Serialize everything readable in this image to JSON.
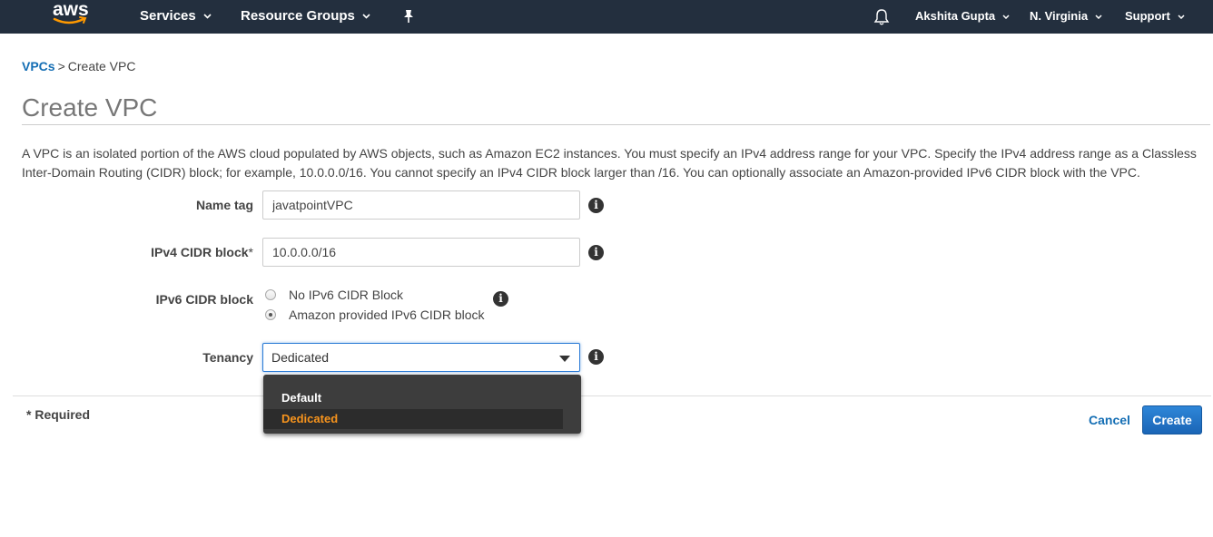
{
  "topnav": {
    "logo_text": "aws",
    "services": "Services",
    "resource_groups": "Resource Groups",
    "user": "Akshita Gupta",
    "region": "N. Virginia",
    "support": "Support",
    "icons": [
      "pin-icon",
      "bell-icon"
    ],
    "background_color": "#232f3e"
  },
  "breadcrumb": {
    "parent": "VPCs",
    "separator": ">",
    "current": "Create VPC"
  },
  "page_title": "Create VPC",
  "description": "A VPC is an isolated portion of the AWS cloud populated by AWS objects, such as Amazon EC2 instances. You must specify an IPv4 address range for your VPC. Specify the IPv4 address range as a Classless Inter-Domain Routing (CIDR) block; for example, 10.0.0.0/16. You cannot specify an IPv4 CIDR block larger than /16. You can optionally associate an Amazon-provided IPv6 CIDR block with the VPC.",
  "form": {
    "name_tag": {
      "label": "Name tag",
      "value": "javatpointVPC"
    },
    "ipv4": {
      "label": "IPv4 CIDR block",
      "required_mark": "*",
      "value": "10.0.0.0/16"
    },
    "ipv6": {
      "label": "IPv6 CIDR block",
      "options": [
        {
          "label": "No IPv6 CIDR Block",
          "checked": false
        },
        {
          "label": "Amazon provided IPv6 CIDR block",
          "checked": true
        }
      ]
    },
    "tenancy": {
      "label": "Tenancy",
      "selected": "Dedicated",
      "options": [
        "Default",
        "Dedicated"
      ],
      "highlight_color": "#f7941d"
    }
  },
  "footer": {
    "required_note": "* Required",
    "cancel": "Cancel",
    "create": "Create",
    "accent_color": "#146eb4"
  }
}
